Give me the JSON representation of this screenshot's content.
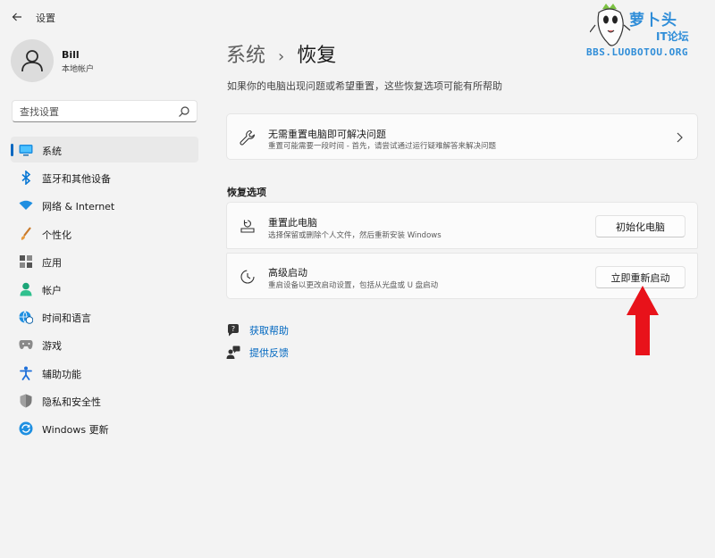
{
  "app": {
    "title": "设置"
  },
  "watermark": {
    "name": "萝卜头",
    "forum": "IT论坛",
    "url": "BBS.LUOBOTOU.ORG"
  },
  "profile": {
    "name": "Bill",
    "account_type": "本地帐户"
  },
  "search": {
    "placeholder": "查找设置"
  },
  "nav": {
    "items": [
      {
        "label": "系统",
        "icon": "monitor-icon",
        "active": true
      },
      {
        "label": "蓝牙和其他设备",
        "icon": "bluetooth-icon"
      },
      {
        "label": "网络 & Internet",
        "icon": "wifi-icon"
      },
      {
        "label": "个性化",
        "icon": "brush-icon"
      },
      {
        "label": "应用",
        "icon": "apps-icon"
      },
      {
        "label": "帐户",
        "icon": "person-icon"
      },
      {
        "label": "时间和语言",
        "icon": "globe-clock-icon"
      },
      {
        "label": "游戏",
        "icon": "gamepad-icon"
      },
      {
        "label": "辅助功能",
        "icon": "accessibility-icon"
      },
      {
        "label": "隐私和安全性",
        "icon": "shield-icon"
      },
      {
        "label": "Windows 更新",
        "icon": "update-icon"
      }
    ]
  },
  "page": {
    "breadcrumb_parent": "系统",
    "breadcrumb_separator": "›",
    "title": "恢复",
    "subtitle": "如果你的电脑出现问题或希望重置，这些恢复选项可能有所帮助"
  },
  "troubleshoot_card": {
    "title": "无需重置电脑即可解决问题",
    "description": "重置可能需要一段时间 - 首先，请尝试通过运行疑难解答来解决问题",
    "icon": "wrench-icon"
  },
  "recovery_options": {
    "section_title": "恢复选项",
    "reset": {
      "title": "重置此电脑",
      "description": "选择保留或删除个人文件，然后重新安装 Windows",
      "button": "初始化电脑",
      "icon": "reset-pc-icon"
    },
    "advanced": {
      "title": "高级启动",
      "description": "重启设备以更改启动设置，包括从光盘或 U 盘启动",
      "button": "立即重新启动",
      "icon": "advanced-startup-icon"
    }
  },
  "links": {
    "help": "获取帮助",
    "feedback": "提供反馈"
  },
  "colors": {
    "accent": "#0067c0",
    "annotation_arrow": "#e8121a"
  }
}
